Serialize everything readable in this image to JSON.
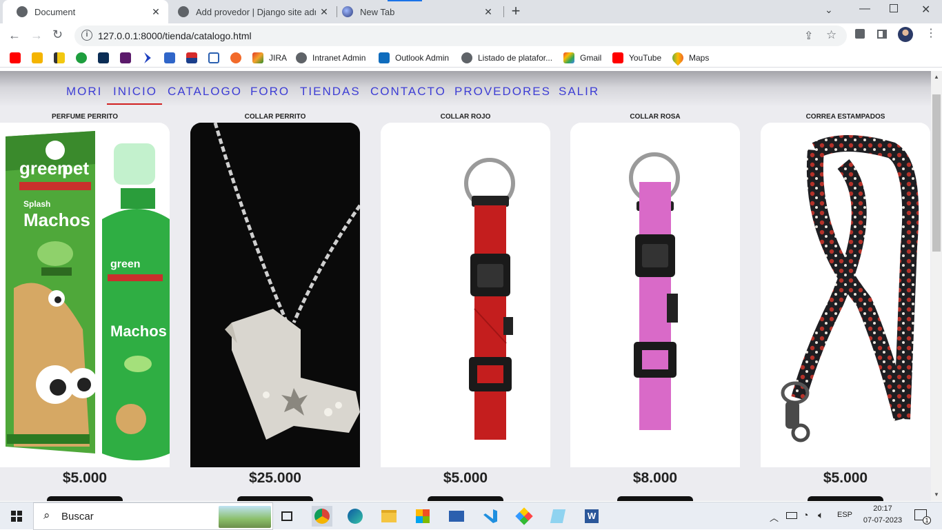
{
  "browser": {
    "tabs": [
      {
        "title": "Document",
        "active": true
      },
      {
        "title": "Add provedor | Django site admin",
        "active": false
      },
      {
        "title": "New Tab",
        "active": false
      }
    ],
    "new_tab_glyph": "+",
    "url": "127.0.0.1:8000/tienda/catalogo.html",
    "bookmarks": [
      {
        "label": "JIRA",
        "icon": "jira-icon"
      },
      {
        "label": "Intranet Admin",
        "icon": "globe-icon"
      },
      {
        "label": "Outlook Admin",
        "icon": "outlook-icon"
      },
      {
        "label": "Listado de platafor...",
        "icon": "globe-icon"
      },
      {
        "label": "Gmail",
        "icon": "gmail-icon"
      },
      {
        "label": "YouTube",
        "icon": "youtube-icon"
      },
      {
        "label": "Maps",
        "icon": "maps-icon"
      }
    ]
  },
  "nav": {
    "items": [
      "MORI",
      "INICIO",
      "CATALOGO",
      "FORO",
      "TIENDAS",
      "CONTACTO",
      "PROVEDORES",
      "SALIR"
    ],
    "active": "INICIO",
    "link_color": "#3d3dd4",
    "active_underline_color": "#d11f1f"
  },
  "products": [
    {
      "name": "PERFUME PERRITO",
      "price": "$5.000",
      "image": "green-pet-perfume-spray"
    },
    {
      "name": "COLLAR PERRITO",
      "price": "$25.000",
      "image": "silver-dog-pendant-necklace"
    },
    {
      "name": "COLLAR ROJO",
      "price": "$5.000",
      "image": "red-dog-collar"
    },
    {
      "name": "COLLAR ROSA",
      "price": "$8.000",
      "image": "pink-dog-collar"
    },
    {
      "name": "CORREA ESTAMPADOS",
      "price": "$5.000",
      "image": "printed-dog-leash"
    }
  ],
  "taskbar": {
    "search_placeholder": "Buscar",
    "language": "ESP",
    "time": "20:17",
    "date": "07-07-2023",
    "notification_count": "1"
  }
}
